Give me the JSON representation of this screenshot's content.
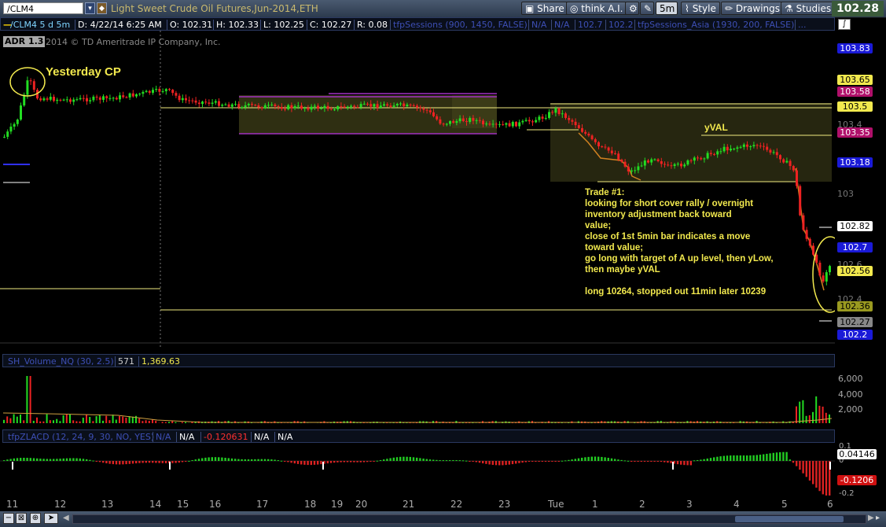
{
  "toolbar": {
    "symbol": "/CLM4",
    "title": "Light Sweet Crude Oil Futures,Jun-2014,ETH",
    "share_label": "Share",
    "think_ai_label": "think A.I.",
    "timeframe_label": "5m",
    "style_label": "Style",
    "drawings_label": "Drawings",
    "studies_label": "Studies",
    "last_price": "102.28"
  },
  "infobar": {
    "symbol_period": "/CLM4 5 d 5m",
    "date": "D: 4/22/14 6:25 AM",
    "open": "O: 102.31",
    "high": "H: 102.33",
    "low": "L: 102.25",
    "close": "C: 102.27",
    "range": "R: 0.08",
    "study1": "tfpSessions (900, 1450, FALSE)",
    "na1": "N/A",
    "na2": "N/A",
    "v1": "102.7",
    "v2": "102.2",
    "study2": "tfpSessions_Asia (1930, 200, FALSE)",
    "ellipsis": "..."
  },
  "main": {
    "adr_label": "ADR 1.3",
    "copyright": "2014 © TD Ameritrade IP Company, Inc.",
    "yesterday_cp": "Yesterday CP",
    "yval": "yVAL",
    "trade_notes": [
      "Trade #1:",
      "looking for short cover rally / overnight",
      "inventory adjustment back toward",
      "value;",
      "close of 1st 5min bar indicates a move",
      "toward value;",
      "go long with target of A up level, then yLow,",
      "then maybe yVAL",
      "",
      "long 10264, stopped out 11min later 10239"
    ]
  },
  "price_axis": {
    "labels": [
      {
        "text": "103.83",
        "style": "blue"
      },
      {
        "text": "103.65",
        "style": "yellow"
      },
      {
        "text": "103.58",
        "style": "magenta"
      },
      {
        "text": "103.5",
        "style": "yellow"
      },
      {
        "text": "103.4",
        "style": "plain"
      },
      {
        "text": "103.35",
        "style": "magenta"
      },
      {
        "text": "103.18",
        "style": "blue"
      },
      {
        "text": "103",
        "style": "plain"
      },
      {
        "text": "102.82",
        "style": "white"
      },
      {
        "text": "102.7",
        "style": "blue"
      },
      {
        "text": "102.6",
        "style": "plain"
      },
      {
        "text": "102.56",
        "style": "yellow"
      },
      {
        "text": "102.4",
        "style": "plain"
      },
      {
        "text": "102.36",
        "style": "olive"
      },
      {
        "text": "102.27",
        "style": "grey"
      },
      {
        "text": "102.2",
        "style": "blue"
      }
    ]
  },
  "volume": {
    "study": "SH_Volume_NQ (30, 2.5)",
    "v1": "571",
    "v2": "1,369.63",
    "axis": [
      "6,000",
      "4,000",
      "2,000"
    ]
  },
  "zlacd": {
    "study": "tfpZLACD (12, 24, 9, 30, NO, YES)",
    "na1": "N/A",
    "na2": "N/A",
    "value": "-0.120631",
    "na3": "N/A",
    "na4": "N/A",
    "axis_top": "0.1",
    "axis_zero": "0",
    "axis_bottom": "-0.2",
    "label_pos": "0.04146",
    "label_neg": "-0.1206"
  },
  "time_axis": [
    "11",
    "12",
    "13",
    "14",
    "15",
    "16",
    "17",
    "18",
    "19",
    "20",
    "21",
    "22",
    "23",
    "Tue",
    "1",
    "2",
    "3",
    "4",
    "5",
    "6"
  ],
  "colors": {
    "up": "#22dd22",
    "down": "#ee2222",
    "level_line": "#f0ea80",
    "value_area": "#4a4a1a",
    "blue_label": "#1a1ad8",
    "magenta_label": "#b0106a"
  }
}
